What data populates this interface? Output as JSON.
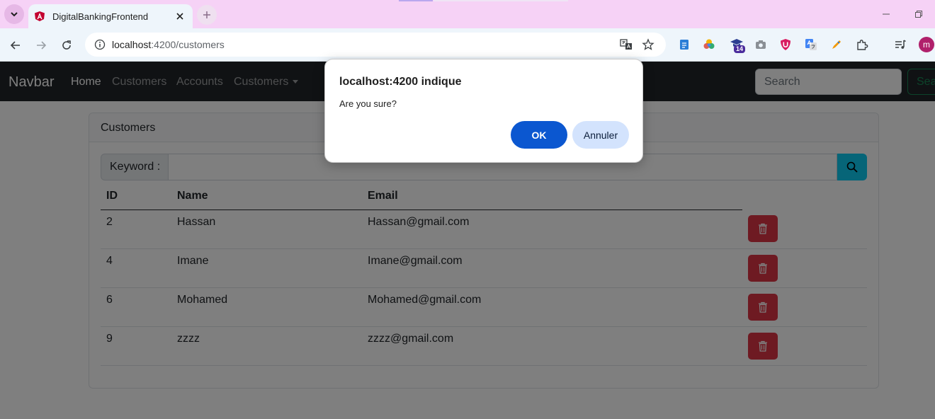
{
  "browser": {
    "tab": {
      "title": "DigitalBankingFrontend"
    },
    "url": {
      "host": "localhost",
      "path": ":4200/customers"
    },
    "extensions": {
      "badge_count": "14"
    },
    "profile_initial": "m"
  },
  "navbar": {
    "brand": "Navbar",
    "links": [
      "Home",
      "Customers",
      "Accounts",
      "Customers"
    ],
    "search_placeholder": "Search",
    "search_button": "Search"
  },
  "card": {
    "header": "Customers",
    "keyword_label": "Keyword :"
  },
  "table": {
    "headers": [
      "ID",
      "Name",
      "Email"
    ],
    "rows": [
      {
        "id": "2",
        "name": "Hassan",
        "email": "Hassan@gmail.com"
      },
      {
        "id": "4",
        "name": "Imane",
        "email": "Imane@gmail.com"
      },
      {
        "id": "6",
        "name": "Mohamed",
        "email": "Mohamed@gmail.com"
      },
      {
        "id": "9",
        "name": "zzzz",
        "email": "zzzz@gmail.com"
      }
    ]
  },
  "dialog": {
    "title": "localhost:4200 indique",
    "message": "Are you sure?",
    "ok": "OK",
    "cancel": "Annuler"
  },
  "colors": {
    "tabstrip": "#f6d2f6",
    "navbar": "#212529",
    "danger": "#dc3545",
    "info": "#0dcaf0",
    "dialog_primary": "#0b57d0"
  }
}
